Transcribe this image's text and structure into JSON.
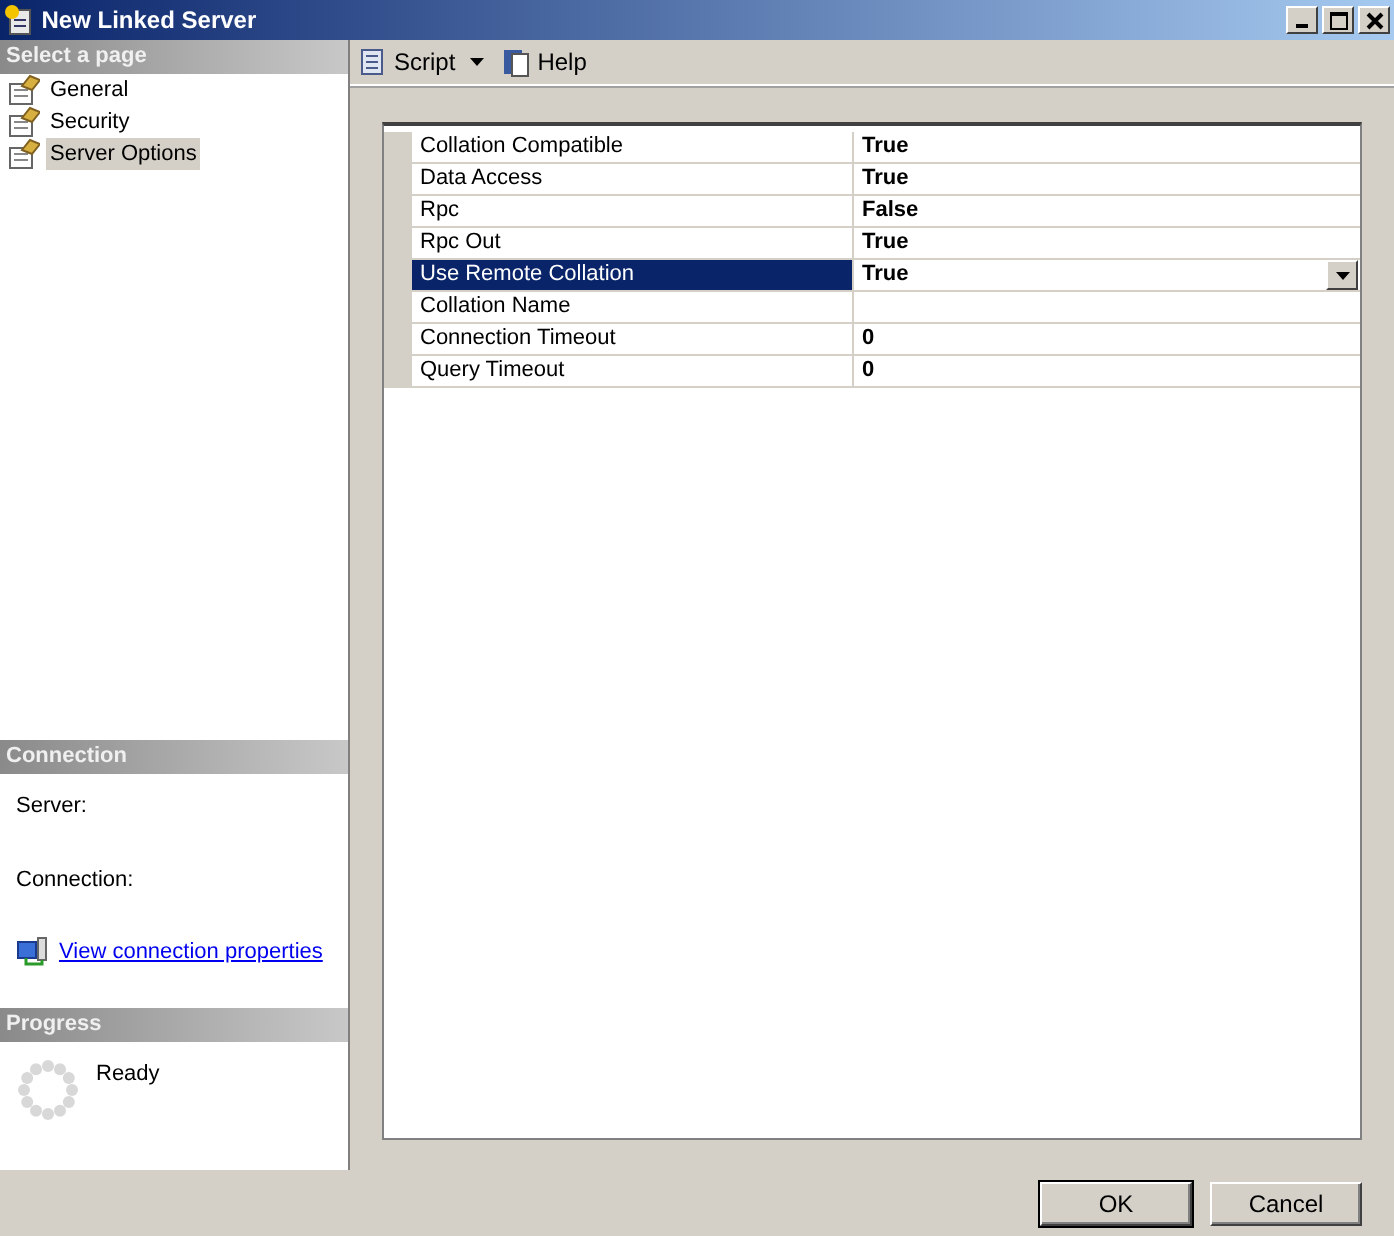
{
  "window": {
    "title": "New Linked Server"
  },
  "sidebar": {
    "header": "Select a page",
    "items": [
      {
        "label": "General",
        "selected": false
      },
      {
        "label": "Security",
        "selected": false
      },
      {
        "label": "Server Options",
        "selected": true
      }
    ]
  },
  "connection": {
    "header": "Connection",
    "server_label": "Server:",
    "connection_label": "Connection:",
    "link": "View connection properties"
  },
  "progress": {
    "header": "Progress",
    "status": "Ready"
  },
  "toolbar": [
    {
      "label": "Script",
      "kind": "script"
    },
    {
      "label": "Help",
      "kind": "help"
    }
  ],
  "properties": [
    {
      "name": "Collation Compatible",
      "value": "True",
      "selected": false
    },
    {
      "name": "Data Access",
      "value": "True",
      "selected": false
    },
    {
      "name": "Rpc",
      "value": "False",
      "selected": false
    },
    {
      "name": "Rpc Out",
      "value": "True",
      "selected": false
    },
    {
      "name": "Use Remote Collation",
      "value": "True",
      "selected": true
    },
    {
      "name": "Collation Name",
      "selected": false
    },
    {
      "name": "Connection Timeout",
      "value": "0",
      "selected": false
    },
    {
      "name": "Query Timeout",
      "value": "0",
      "selected": false
    }
  ],
  "buttons": [
    "OK",
    "Cancel"
  ]
}
